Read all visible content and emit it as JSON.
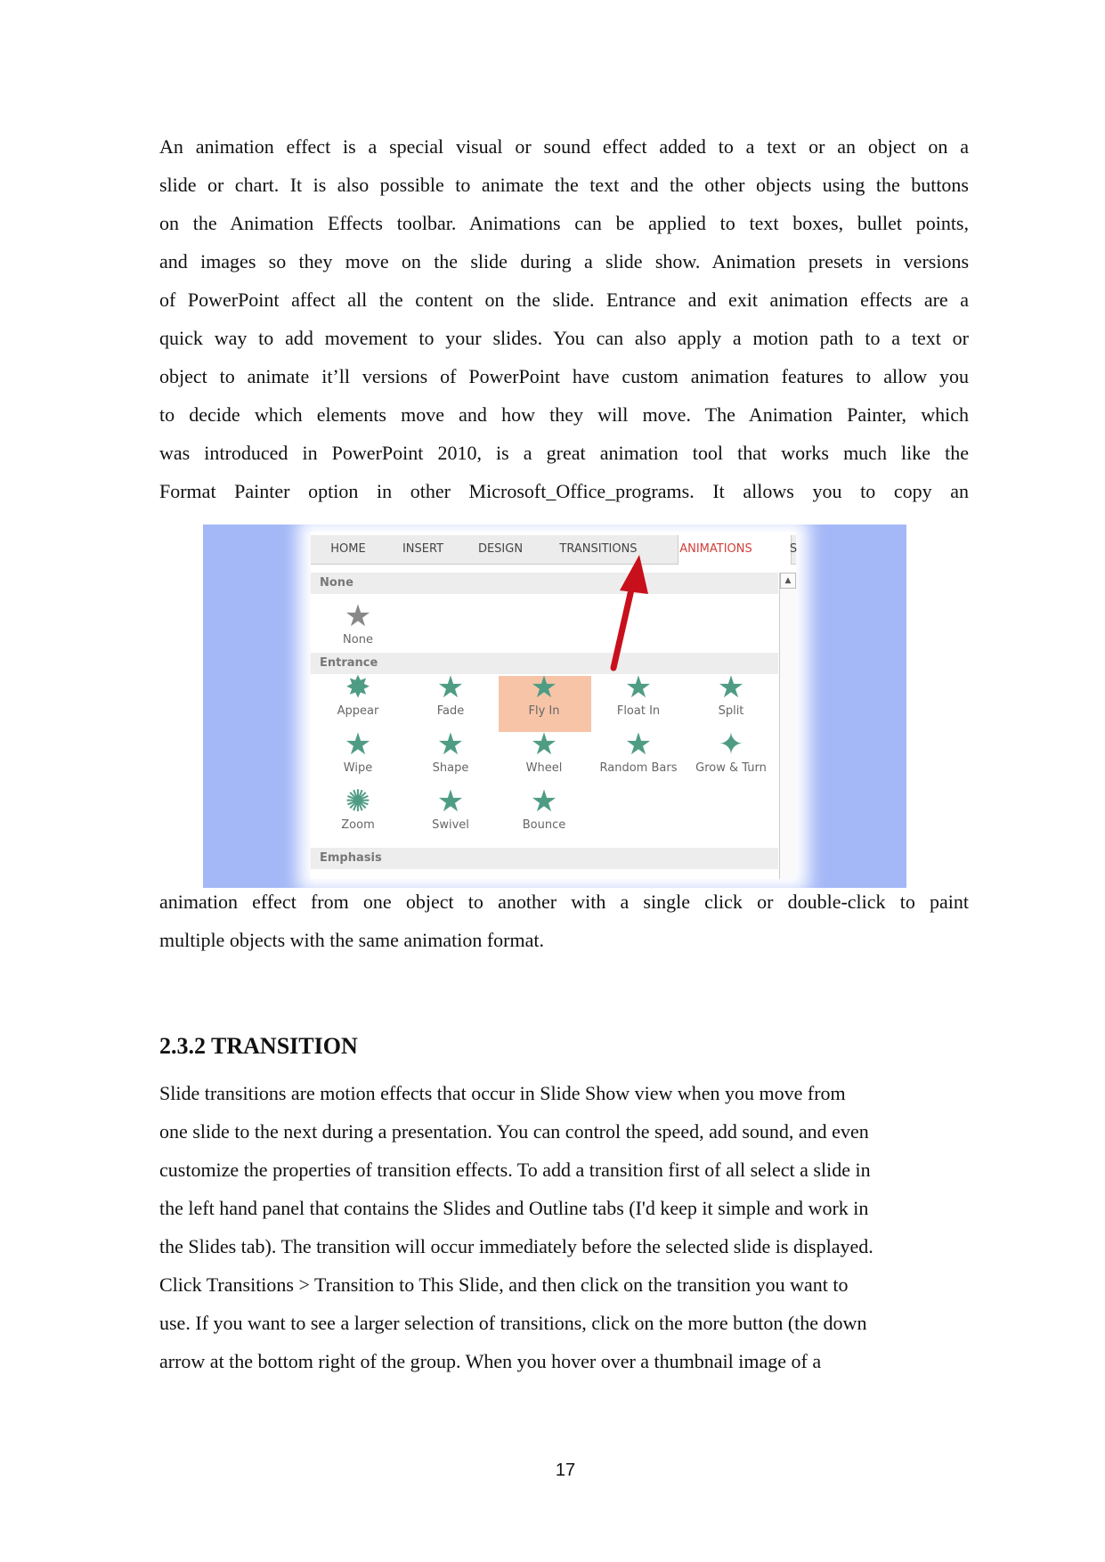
{
  "paragraph1": [
    "An animation effect is a special visual or sound effect added to a text or an object on a",
    "slide or chart. It is also possible to animate the text and the other objects using the buttons",
    "on the Animation Effects toolbar. Animations can be applied to text boxes, bullet points,",
    "and images so they move on the slide during a slide show. Animation presets in versions",
    "of PowerPoint affect all the content on the slide. Entrance and exit animation effects are a",
    "quick way to add movement to your slides. You can also apply a motion path to a text or",
    "object to animate it’ll versions of PowerPoint have custom animation features to allow you",
    "to decide which elements move and how they will move. The Animation Painter, which",
    "was introduced in PowerPoint 2010, is a great animation tool that works much like the",
    "Format Painter option in other Microsoft_Office_programs. It allows you to copy an"
  ],
  "paragraph2": [
    "animation effect from one object to another with a single click or double-click to paint",
    "multiple objects with the same animation format."
  ],
  "heading": "2.3.2 TRANSITION",
  "paragraph3": [
    " Slide transitions are motion effects that occur in Slide Show view when you move from",
    "one slide to the next during a presentation. You can control the speed, add sound, and even",
    "customize the properties of transition effects. To add a transition first of all select a slide in",
    "the left hand panel that contains the Slides and Outline tabs (I'd keep it simple and work in",
    "the Slides tab). The transition will occur immediately before the selected slide is displayed.",
    "Click Transitions > Transition to This Slide, and then click on the transition you want to",
    "use. If you want to see a larger selection of transitions, click on the more button (the down",
    "arrow at the bottom right of the group. When you hover over a thumbnail image of a"
  ],
  "page_number": "17",
  "figure": {
    "tabs": [
      "HOME",
      "INSERT",
      "DESIGN",
      "TRANSITIONS",
      "ANIMATIONS",
      "S"
    ],
    "active_tab": "ANIMATIONS",
    "sections": {
      "none": "None",
      "entrance": "Entrance",
      "emphasis": "Emphasis"
    },
    "none_item": "None",
    "entrance_items": [
      "Appear",
      "Fade",
      "Fly In",
      "Float In",
      "Split",
      "Wipe",
      "Shape",
      "Wheel",
      "Random Bars",
      "Grow & Turn",
      "Zoom",
      "Swivel",
      "Bounce"
    ],
    "selected_item": "Fly In",
    "colors": {
      "background": "#a4b8f7",
      "icon": "#4f9c85",
      "highlight": "#f7c4a8",
      "arrow": "#c8101c",
      "active_tab": "#d0403a"
    }
  }
}
